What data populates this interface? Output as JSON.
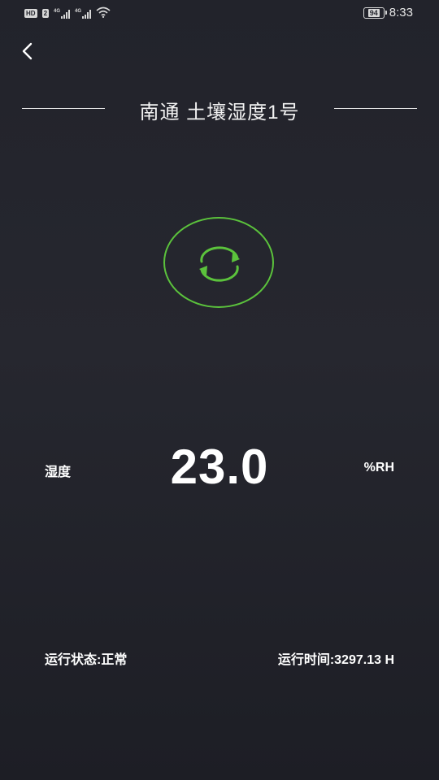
{
  "status_bar": {
    "hd_badge": "HD",
    "sim_badge": "2",
    "signal_label_1": "4G",
    "signal_label_2": "4G",
    "battery_level": "94",
    "time": "8:33",
    "icons": [
      "hd-icon",
      "signal-icon",
      "signal-icon",
      "wifi-icon",
      "battery-icon"
    ]
  },
  "header": {
    "back_icon": "back-arrow-icon",
    "title": "南通 土壤湿度1号"
  },
  "refresh": {
    "icon": "refresh-icon",
    "accent_color": "#5bc23c"
  },
  "metric": {
    "label": "湿度",
    "value": "23.0",
    "unit": "%RH"
  },
  "footer": {
    "run_status": "运行状态:正常",
    "run_time": "运行时间:3297.13 H"
  }
}
